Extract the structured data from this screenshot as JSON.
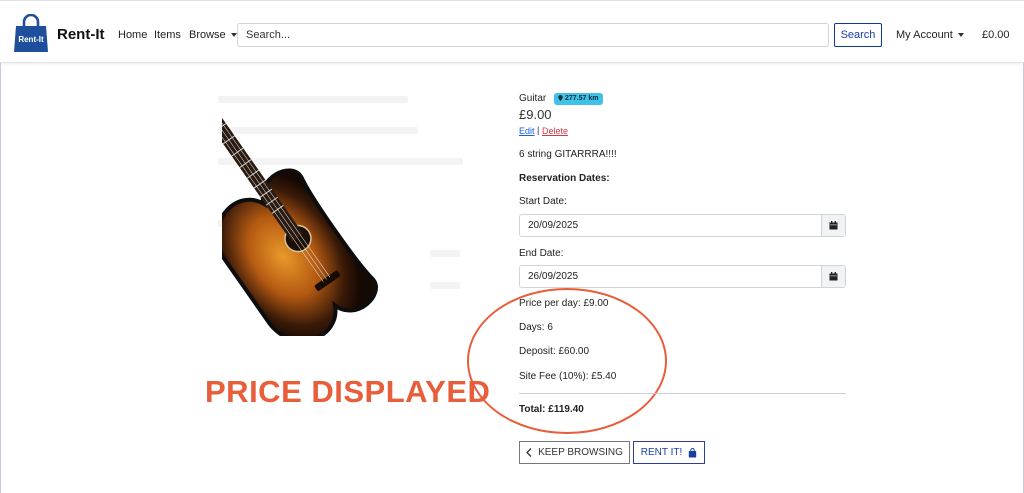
{
  "navbar": {
    "brand": "Rent-It",
    "logo_text": "Rent-It",
    "links": {
      "home": "Home",
      "items": "Items",
      "browse": "Browse"
    },
    "search": {
      "placeholder": "Search...",
      "button_label": "Search"
    },
    "account_label": "My Account",
    "cart_total": "£0.00"
  },
  "item": {
    "name": "Guitar",
    "distance": "277.57 km",
    "price": "£9.00",
    "edit_label": "Edit",
    "separator": "|",
    "delete_label": "Delete",
    "description": "6 string GITARRRA!!!!"
  },
  "reservation": {
    "heading": "Reservation Dates:",
    "start_label": "Start Date:",
    "start_value": "20/09/2025",
    "end_label": "End Date:",
    "end_value": "26/09/2025"
  },
  "summary": {
    "price_per_day": "Price per day: £9.00",
    "days": "Days: 6",
    "deposit": "Deposit: £60.00",
    "site_fee": "Site Fee (10%): £5.40",
    "total": "Total: £119.40"
  },
  "actions": {
    "keep_browsing": "KEEP BROWSING",
    "rent_it": "RENT IT!"
  },
  "annotation": {
    "text": "PRICE DISPLAYED",
    "color": "#e85d3a"
  },
  "colors": {
    "brand_blue": "#1f4f9c",
    "link_blue": "#1a5fd6",
    "delete_red": "#d33a4a",
    "badge_cyan": "#3fc1e8"
  }
}
